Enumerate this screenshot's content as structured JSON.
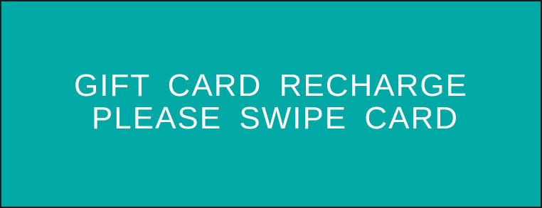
{
  "screen": {
    "background_color": "#00a9a6",
    "text_color": "#ffffff",
    "message_line_1": "GIFT CARD RECHARGE",
    "message_line_2": "PLEASE SWIPE CARD"
  }
}
